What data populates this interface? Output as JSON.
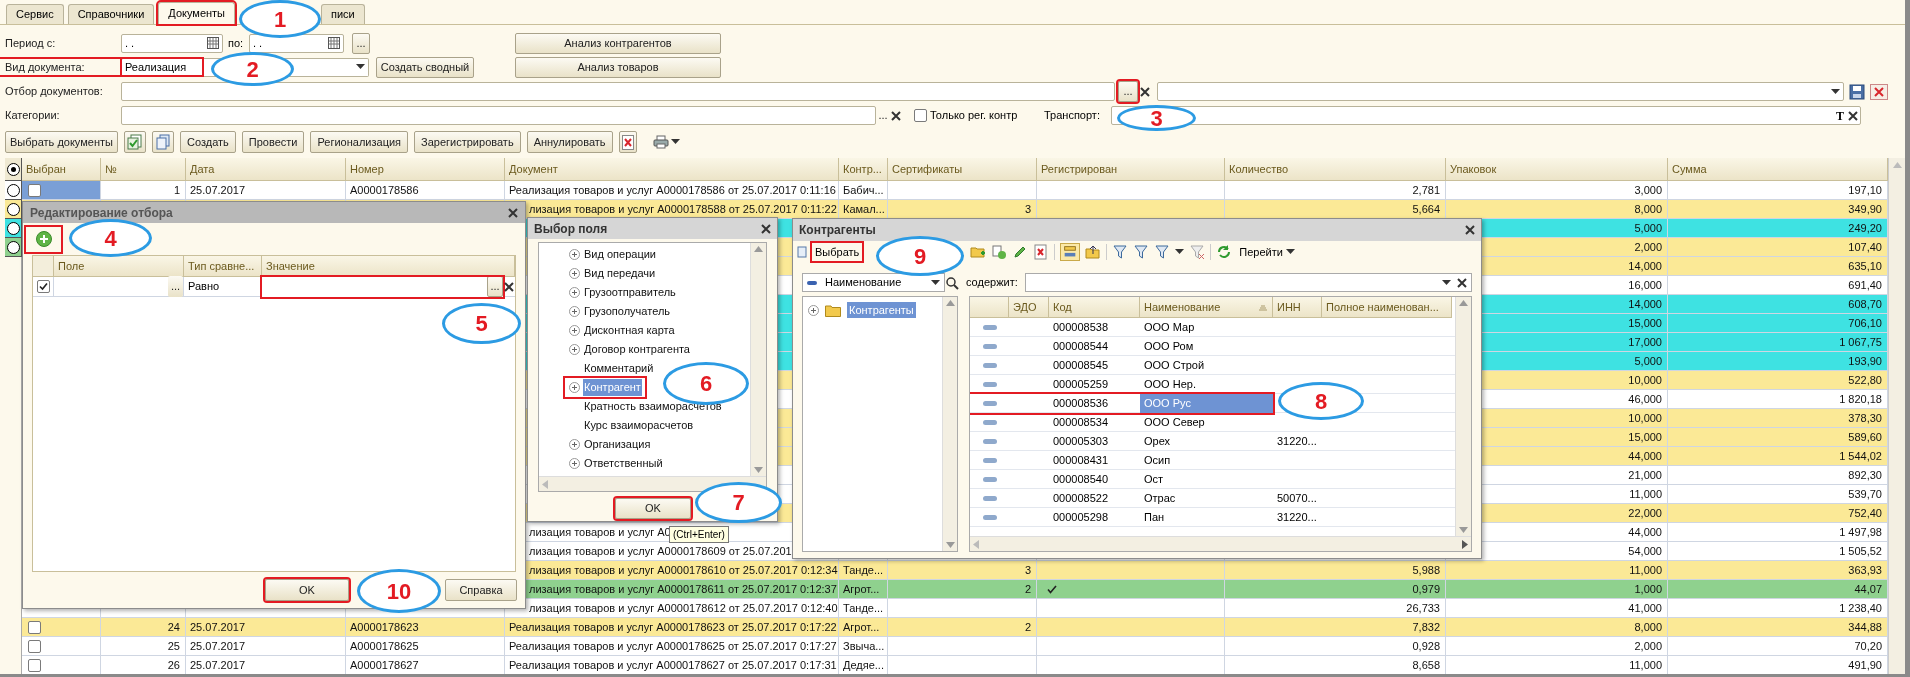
{
  "tabs": [
    {
      "label": "Сервис",
      "selected": false,
      "highlighted": false
    },
    {
      "label": "Справочники",
      "selected": false,
      "highlighted": false
    },
    {
      "label": "Документы",
      "selected": true,
      "highlighted": true
    },
    {
      "label": "писи",
      "selected": false,
      "highlighted": false
    }
  ],
  "form": {
    "period_label": "Период с:",
    "period_from": ". .",
    "period_to_label": "по:",
    "period_to": ". .",
    "period_button": "...",
    "analysis_buttons": [
      "Анализ контрагентов",
      "Анализ товаров"
    ],
    "doc_type_label": "Вид документа:",
    "doc_type": "Реализация",
    "doc_type_highlighted": true,
    "create_summary": "Создать сводный",
    "doc_filter_label": "Отбор документов:",
    "doc_filter_button": "...",
    "doc_filter_button_highlighted": true,
    "categories_label": "Категории:",
    "categories_button": "...",
    "only_registered": {
      "label": "Только рег. контр",
      "checked": false
    },
    "transport_label": "Транспорт:",
    "transport_button": "T"
  },
  "toolbar": [
    "Выбрать документы",
    "Создать",
    "Провести",
    "Регионализация",
    "Зарегистрировать",
    "Аннулировать"
  ],
  "table": {
    "columns": [
      "Выбран",
      "№",
      "Дата",
      "Номер",
      "Документ",
      "Контр...",
      "Сертификаты",
      "Регистрирован",
      "Количество",
      "Упаковок",
      "Сумма"
    ],
    "legend": [
      {
        "selected": true,
        "color": "#efe9d2"
      },
      {
        "selected": false,
        "color": "#ffffff"
      },
      {
        "selected": false,
        "color": "#fbe996"
      },
      {
        "selected": false,
        "color": "#3ee2e2"
      },
      {
        "selected": false,
        "color": "#8fd18e"
      }
    ],
    "rows": [
      {
        "color": "#ffffff",
        "selected": true,
        "checked": false,
        "number": "1",
        "date": "25.07.2017",
        "doc_no": "A0000178586",
        "document": "Реализация товаров и услуг A0000178586 от 25.07.2017 0:11:16",
        "counterparty": "Бабич...",
        "registered": false,
        "quantity": "2,781",
        "packages": "3,000",
        "sum": "197,10"
      },
      {
        "color": "#fbe996",
        "document": "лизация товаров и услуг A0000178588 от 25.07.2017 0:11:22",
        "counterparty": "Камал...",
        "certificates": "3",
        "registered": false,
        "quantity": "5,664",
        "packages": "8,000",
        "sum": "349,90"
      },
      {
        "color": "#3ee2e2",
        "packages": "5,000",
        "sum": "249,20"
      },
      {
        "color": "#fbe996",
        "packages": "2,000",
        "sum": "107,40"
      },
      {
        "color": "#fbe996",
        "packages": "14,000",
        "sum": "635,10"
      },
      {
        "color": "#ffffff",
        "packages": "16,000",
        "sum": "691,40"
      },
      {
        "color": "#3ee2e2",
        "packages": "14,000",
        "sum": "608,70"
      },
      {
        "color": "#3ee2e2",
        "packages": "15,000",
        "sum": "706,10"
      },
      {
        "color": "#3ee2e2",
        "packages": "17,000",
        "sum": "1 067,75"
      },
      {
        "color": "#3ee2e2",
        "packages": "5,000",
        "sum": "193,90"
      },
      {
        "color": "#fbe996",
        "packages": "10,000",
        "sum": "522,80"
      },
      {
        "color": "#ffffff",
        "packages": "46,000",
        "sum": "1 820,18"
      },
      {
        "color": "#fbe996",
        "packages": "10,000",
        "sum": "378,30"
      },
      {
        "color": "#fbe996",
        "packages": "15,000",
        "sum": "589,60"
      },
      {
        "color": "#fbe996",
        "packages": "44,000",
        "sum": "1 544,02"
      },
      {
        "color": "#ffffff",
        "packages": "21,000",
        "sum": "892,30"
      },
      {
        "color": "#ffffff",
        "packages": "11,000",
        "sum": "539,70"
      },
      {
        "color": "#fbe996",
        "packages": "22,000",
        "sum": "752,40"
      },
      {
        "color": "#ffffff",
        "document": "лизация товаров и услуг A0",
        "packages": "44,000",
        "sum": "1 497,98"
      },
      {
        "color": "#ffffff",
        "document": "лизация товаров и услуг A0000178609 от 25.07.201",
        "packages": "54,000",
        "sum": "1 505,52"
      },
      {
        "color": "#fbe996",
        "document": "лизация товаров и услуг A0000178610 от 25.07.2017 0:12:34",
        "counterparty": "Танде...",
        "certificates": "3",
        "registered": false,
        "quantity": "5,988",
        "packages": "11,000",
        "sum": "363,93"
      },
      {
        "color": "#8fd18e",
        "document": "лизация товаров и услуг A0000178611 от 25.07.2017 0:12:37",
        "counterparty": "Агрот...",
        "certificates": "2",
        "registered": true,
        "quantity": "0,979",
        "packages": "1,000",
        "sum": "44,07"
      },
      {
        "color": "#ffffff",
        "document": "лизация товаров и услуг A0000178612 от 25.07.2017 0:12:40",
        "counterparty": "Танде...",
        "registered": false,
        "quantity": "26,733",
        "packages": "41,000",
        "sum": "1 238,40"
      },
      {
        "color": "#fbe996",
        "selected": false,
        "checked": false,
        "number": "24",
        "date": "25.07.2017",
        "doc_no": "A0000178623",
        "document": "Реализация товаров и услуг A0000178623 от 25.07.2017 0:17:22",
        "counterparty": "Агрот...",
        "certificates": "2",
        "registered": false,
        "quantity": "7,832",
        "packages": "8,000",
        "sum": "344,88"
      },
      {
        "color": "#ffffff",
        "selected": false,
        "checked": false,
        "number": "25",
        "date": "25.07.2017",
        "doc_no": "A0000178625",
        "document": "Реализация товаров и услуг A0000178625 от 25.07.2017 0:17:27",
        "counterparty": "Звыча...",
        "registered": false,
        "quantity": "0,928",
        "packages": "2,000",
        "sum": "70,20"
      },
      {
        "color": "#ffffff",
        "selected": false,
        "checked": false,
        "number": "26",
        "date": "25.07.2017",
        "doc_no": "A0000178627",
        "document": "Реализация товаров и услуг A0000178627 от 25.07.2017 0:17:31",
        "counterparty": "Дедяе...",
        "registered": false,
        "quantity": "8,658",
        "packages": "11,000",
        "sum": "491,90"
      }
    ]
  },
  "edit_dialog": {
    "title": "Редактирование отбора",
    "add_highlighted": true,
    "columns": [
      "Поле",
      "Тип сравне...",
      "Значение"
    ],
    "rows": [
      {
        "checked": true,
        "field_button": "...",
        "comparison": "Равно",
        "value_button": "...",
        "value_highlighted": true
      }
    ],
    "buttons": [
      {
        "label": "OK",
        "highlighted": true
      },
      {
        "label": "Справка",
        "highlighted": false
      }
    ]
  },
  "field_dialog": {
    "title": "Выбор поля",
    "items": [
      {
        "label": "Вид операции",
        "expandable": true,
        "selected": false,
        "highlighted": false
      },
      {
        "label": "Вид передачи",
        "expandable": true,
        "selected": false,
        "highlighted": false
      },
      {
        "label": "Грузоотправитель",
        "expandable": true,
        "selected": false,
        "highlighted": false
      },
      {
        "label": "Грузополучатель",
        "expandable": true,
        "selected": false,
        "highlighted": false
      },
      {
        "label": "Дисконтная карта",
        "expandable": true,
        "selected": false,
        "highlighted": false
      },
      {
        "label": "Договор контрагента",
        "expandable": true,
        "selected": false,
        "highlighted": false
      },
      {
        "label": "Комментарий",
        "expandable": false,
        "selected": false,
        "highlighted": false
      },
      {
        "label": "Контрагент",
        "expandable": true,
        "selected": true,
        "highlighted": true
      },
      {
        "label": "Кратность взаиморасчетов",
        "expandable": false,
        "selected": false,
        "highlighted": false
      },
      {
        "label": "Курс взаиморасчетов",
        "expandable": false,
        "selected": false,
        "highlighted": false
      },
      {
        "label": "Организация",
        "expandable": true,
        "selected": false,
        "highlighted": false
      },
      {
        "label": "Ответственный",
        "expandable": true,
        "selected": false,
        "highlighted": false
      }
    ],
    "ok": {
      "label": "OK",
      "highlighted": true
    },
    "tooltip": "(Ctrl+Enter)"
  },
  "counterparty_dialog": {
    "title": "Контрагенты",
    "select_button": {
      "label": "Выбрать",
      "highlighted": true
    },
    "goto_button": "Перейти",
    "search_field": "Наименование",
    "contains_label": "содержит:",
    "tree": [
      {
        "label": "Контрагенты",
        "selected": true
      }
    ],
    "columns": [
      "ЭДО",
      "Код",
      "Наименование",
      "ИНН",
      "Полное наименован..."
    ],
    "rows": [
      {
        "code": "000008538",
        "name": "ООО Мар",
        "selected": false,
        "highlighted": false
      },
      {
        "code": "000008544",
        "name": "ООО Ром",
        "selected": false,
        "highlighted": false
      },
      {
        "code": "000008545",
        "name": "ООО Строй",
        "selected": false,
        "highlighted": false
      },
      {
        "code": "000005259",
        "name": "ООО Нер.",
        "selected": false,
        "highlighted": false
      },
      {
        "code": "000008536",
        "name": "ООО Рус",
        "selected": true,
        "highlighted": true
      },
      {
        "code": "000008534",
        "name": "ООО Север",
        "selected": false,
        "highlighted": false
      },
      {
        "code": "000005303",
        "name": "Орех",
        "inn": "31220...",
        "selected": false,
        "highlighted": false
      },
      {
        "code": "000008431",
        "name": "Осип",
        "selected": false,
        "highlighted": false
      },
      {
        "code": "000008540",
        "name": "Ост",
        "selected": false,
        "highlighted": false
      },
      {
        "code": "000008522",
        "name": "Отрас",
        "inn": "50070...",
        "selected": false,
        "highlighted": false
      },
      {
        "code": "000005298",
        "name": "Пан",
        "inn": "31220...",
        "selected": false,
        "highlighted": false
      }
    ]
  },
  "annotations": [
    {
      "number": "1"
    },
    {
      "number": "2"
    },
    {
      "number": "3"
    },
    {
      "number": "4"
    },
    {
      "number": "5"
    },
    {
      "number": "6"
    },
    {
      "number": "7"
    },
    {
      "number": "8"
    },
    {
      "number": "9"
    },
    {
      "number": "10"
    }
  ]
}
